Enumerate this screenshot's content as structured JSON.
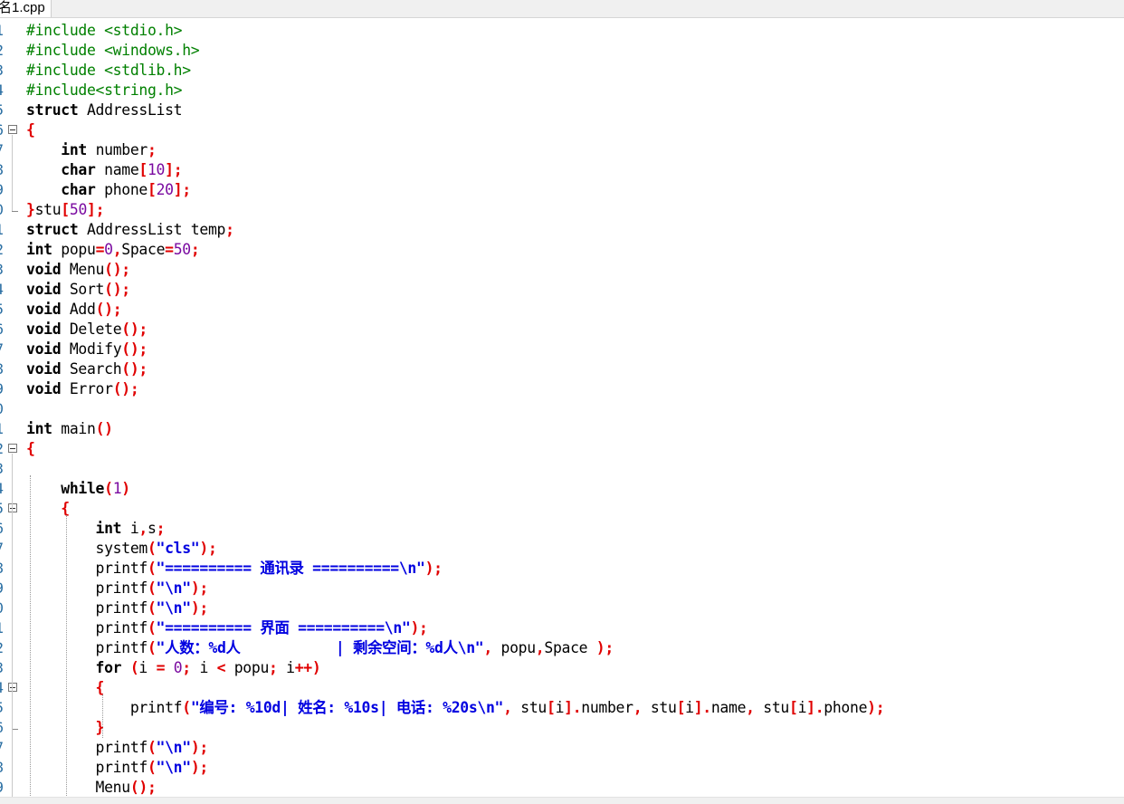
{
  "tab": {
    "title": "名1.cpp"
  },
  "colors": {
    "preprocessor": "#008000",
    "keyword": "#000000",
    "symbol": "#e00000",
    "number": "#7a0aa0",
    "string": "#0000e0",
    "line_number": "#2b6fa3"
  },
  "lines": [
    {
      "no": "1",
      "fold": "",
      "tokens": [
        [
          "pp",
          "#include <stdio.h>"
        ]
      ]
    },
    {
      "no": "2",
      "fold": "",
      "tokens": [
        [
          "pp",
          "#include <windows.h>"
        ]
      ]
    },
    {
      "no": "3",
      "fold": "",
      "tokens": [
        [
          "pp",
          "#include <stdlib.h>"
        ]
      ]
    },
    {
      "no": "4",
      "fold": "",
      "tokens": [
        [
          "pp",
          "#include<string.h>"
        ]
      ]
    },
    {
      "no": "5",
      "fold": "",
      "tokens": [
        [
          "kw",
          "struct"
        ],
        [
          "",
          " AddressList"
        ]
      ]
    },
    {
      "no": "6",
      "fold": "open",
      "tokens": [
        [
          "sym",
          "{"
        ]
      ]
    },
    {
      "no": "7",
      "fold": "",
      "tokens": [
        [
          "",
          "    "
        ],
        [
          "kw",
          "int"
        ],
        [
          "",
          " number"
        ],
        [
          "sym",
          ";"
        ]
      ]
    },
    {
      "no": "8",
      "fold": "",
      "tokens": [
        [
          "",
          "    "
        ],
        [
          "kw",
          "char"
        ],
        [
          "",
          " name"
        ],
        [
          "sym",
          "["
        ],
        [
          "num",
          "10"
        ],
        [
          "sym",
          "];"
        ]
      ]
    },
    {
      "no": "9",
      "fold": "",
      "tokens": [
        [
          "",
          "    "
        ],
        [
          "kw",
          "char"
        ],
        [
          "",
          " phone"
        ],
        [
          "sym",
          "["
        ],
        [
          "num",
          "20"
        ],
        [
          "sym",
          "];"
        ]
      ]
    },
    {
      "no": "0",
      "fold": "end",
      "tokens": [
        [
          "sym",
          "}"
        ],
        [
          "",
          "stu"
        ],
        [
          "sym",
          "["
        ],
        [
          "num",
          "50"
        ],
        [
          "sym",
          "];"
        ]
      ]
    },
    {
      "no": "1",
      "fold": "",
      "tokens": [
        [
          "kw",
          "struct"
        ],
        [
          "",
          " AddressList temp"
        ],
        [
          "sym",
          ";"
        ]
      ]
    },
    {
      "no": "2",
      "fold": "",
      "tokens": [
        [
          "kw",
          "int"
        ],
        [
          "",
          " popu"
        ],
        [
          "sym",
          "="
        ],
        [
          "num",
          "0"
        ],
        [
          "sym",
          ","
        ],
        [
          "",
          "Space"
        ],
        [
          "sym",
          "="
        ],
        [
          "num",
          "50"
        ],
        [
          "sym",
          ";"
        ]
      ]
    },
    {
      "no": "3",
      "fold": "",
      "tokens": [
        [
          "kw",
          "void"
        ],
        [
          "",
          " Menu"
        ],
        [
          "sym",
          "();"
        ]
      ]
    },
    {
      "no": "4",
      "fold": "",
      "tokens": [
        [
          "kw",
          "void"
        ],
        [
          "",
          " Sort"
        ],
        [
          "sym",
          "();"
        ]
      ]
    },
    {
      "no": "5",
      "fold": "",
      "tokens": [
        [
          "kw",
          "void"
        ],
        [
          "",
          " Add"
        ],
        [
          "sym",
          "();"
        ]
      ]
    },
    {
      "no": "6",
      "fold": "",
      "tokens": [
        [
          "kw",
          "void"
        ],
        [
          "",
          " Delete"
        ],
        [
          "sym",
          "();"
        ]
      ]
    },
    {
      "no": "7",
      "fold": "",
      "tokens": [
        [
          "kw",
          "void"
        ],
        [
          "",
          " Modify"
        ],
        [
          "sym",
          "();"
        ]
      ]
    },
    {
      "no": "8",
      "fold": "",
      "tokens": [
        [
          "kw",
          "void"
        ],
        [
          "",
          " Search"
        ],
        [
          "sym",
          "();"
        ]
      ]
    },
    {
      "no": "9",
      "fold": "",
      "tokens": [
        [
          "kw",
          "void"
        ],
        [
          "",
          " Error"
        ],
        [
          "sym",
          "();"
        ]
      ]
    },
    {
      "no": "0",
      "fold": "",
      "tokens": []
    },
    {
      "no": "1",
      "fold": "",
      "tokens": [
        [
          "kw",
          "int"
        ],
        [
          "",
          " main"
        ],
        [
          "sym",
          "()"
        ]
      ]
    },
    {
      "no": "2",
      "fold": "open",
      "tokens": [
        [
          "sym",
          "{"
        ]
      ]
    },
    {
      "no": "3",
      "fold": "",
      "tokens": []
    },
    {
      "no": "4",
      "fold": "",
      "tokens": [
        [
          "",
          "    "
        ],
        [
          "kw",
          "while"
        ],
        [
          "sym",
          "("
        ],
        [
          "num",
          "1"
        ],
        [
          "sym",
          ")"
        ]
      ]
    },
    {
      "no": "5",
      "fold": "open",
      "tokens": [
        [
          "",
          "    "
        ],
        [
          "sym",
          "{"
        ]
      ]
    },
    {
      "no": "6",
      "fold": "",
      "tokens": [
        [
          "",
          "        "
        ],
        [
          "kw",
          "int"
        ],
        [
          "",
          " i"
        ],
        [
          "sym",
          ","
        ],
        [
          "",
          "s"
        ],
        [
          "sym",
          ";"
        ]
      ]
    },
    {
      "no": "7",
      "fold": "",
      "tokens": [
        [
          "",
          "        system"
        ],
        [
          "sym",
          "("
        ],
        [
          "str",
          "\"cls\""
        ],
        [
          "sym",
          ");"
        ]
      ]
    },
    {
      "no": "8",
      "fold": "",
      "tokens": [
        [
          "",
          "        printf"
        ],
        [
          "sym",
          "("
        ],
        [
          "str",
          "\"========== 通讯录 ==========\\n\""
        ],
        [
          "sym",
          ");"
        ]
      ]
    },
    {
      "no": "9",
      "fold": "",
      "tokens": [
        [
          "",
          "        printf"
        ],
        [
          "sym",
          "("
        ],
        [
          "str",
          "\"\\n\""
        ],
        [
          "sym",
          ");"
        ]
      ]
    },
    {
      "no": "0",
      "fold": "",
      "tokens": [
        [
          "",
          "        printf"
        ],
        [
          "sym",
          "("
        ],
        [
          "str",
          "\"\\n\""
        ],
        [
          "sym",
          ");"
        ]
      ]
    },
    {
      "no": "1",
      "fold": "",
      "tokens": [
        [
          "",
          "        printf"
        ],
        [
          "sym",
          "("
        ],
        [
          "str",
          "\"========== 界面 ==========\\n\""
        ],
        [
          "sym",
          ");"
        ]
      ]
    },
    {
      "no": "2",
      "fold": "",
      "tokens": [
        [
          "",
          "        printf"
        ],
        [
          "sym",
          "("
        ],
        [
          "str",
          "\"人数：%d人           | 剩余空间：%d人\\n\""
        ],
        [
          "sym",
          ","
        ],
        [
          "",
          " popu"
        ],
        [
          "sym",
          ","
        ],
        [
          "",
          "Space "
        ],
        [
          "sym",
          ");"
        ]
      ]
    },
    {
      "no": "3",
      "fold": "",
      "tokens": [
        [
          "",
          "        "
        ],
        [
          "kw",
          "for"
        ],
        [
          "",
          " "
        ],
        [
          "sym",
          "("
        ],
        [
          "",
          "i "
        ],
        [
          "sym",
          "="
        ],
        [
          "",
          " "
        ],
        [
          "num",
          "0"
        ],
        [
          "sym",
          ";"
        ],
        [
          "",
          " i "
        ],
        [
          "sym",
          "<"
        ],
        [
          "",
          " popu"
        ],
        [
          "sym",
          ";"
        ],
        [
          "",
          " i"
        ],
        [
          "sym",
          "++)"
        ]
      ]
    },
    {
      "no": "4",
      "fold": "open",
      "tokens": [
        [
          "",
          "        "
        ],
        [
          "sym",
          "{"
        ]
      ]
    },
    {
      "no": "5",
      "fold": "",
      "tokens": [
        [
          "",
          "            printf"
        ],
        [
          "sym",
          "("
        ],
        [
          "str",
          "\"编号: %10d| 姓名: %10s| 电话: %20s\\n\""
        ],
        [
          "sym",
          ","
        ],
        [
          "",
          " stu"
        ],
        [
          "sym",
          "["
        ],
        [
          "",
          "i"
        ],
        [
          "sym",
          "]."
        ],
        [
          "",
          "number"
        ],
        [
          "sym",
          ","
        ],
        [
          "",
          " stu"
        ],
        [
          "sym",
          "["
        ],
        [
          "",
          "i"
        ],
        [
          "sym",
          "]."
        ],
        [
          "",
          "name"
        ],
        [
          "sym",
          ","
        ],
        [
          "",
          " stu"
        ],
        [
          "sym",
          "["
        ],
        [
          "",
          "i"
        ],
        [
          "sym",
          "]."
        ],
        [
          "",
          "phone"
        ],
        [
          "sym",
          ");"
        ]
      ]
    },
    {
      "no": "6",
      "fold": "end",
      "tokens": [
        [
          "",
          "        "
        ],
        [
          "sym",
          "}"
        ]
      ]
    },
    {
      "no": "7",
      "fold": "",
      "tokens": [
        [
          "",
          "        printf"
        ],
        [
          "sym",
          "("
        ],
        [
          "str",
          "\"\\n\""
        ],
        [
          "sym",
          ");"
        ]
      ]
    },
    {
      "no": "8",
      "fold": "",
      "tokens": [
        [
          "",
          "        printf"
        ],
        [
          "sym",
          "("
        ],
        [
          "str",
          "\"\\n\""
        ],
        [
          "sym",
          ");"
        ]
      ]
    },
    {
      "no": "9",
      "fold": "",
      "tokens": [
        [
          "",
          "        Menu"
        ],
        [
          "sym",
          "();"
        ]
      ]
    }
  ]
}
